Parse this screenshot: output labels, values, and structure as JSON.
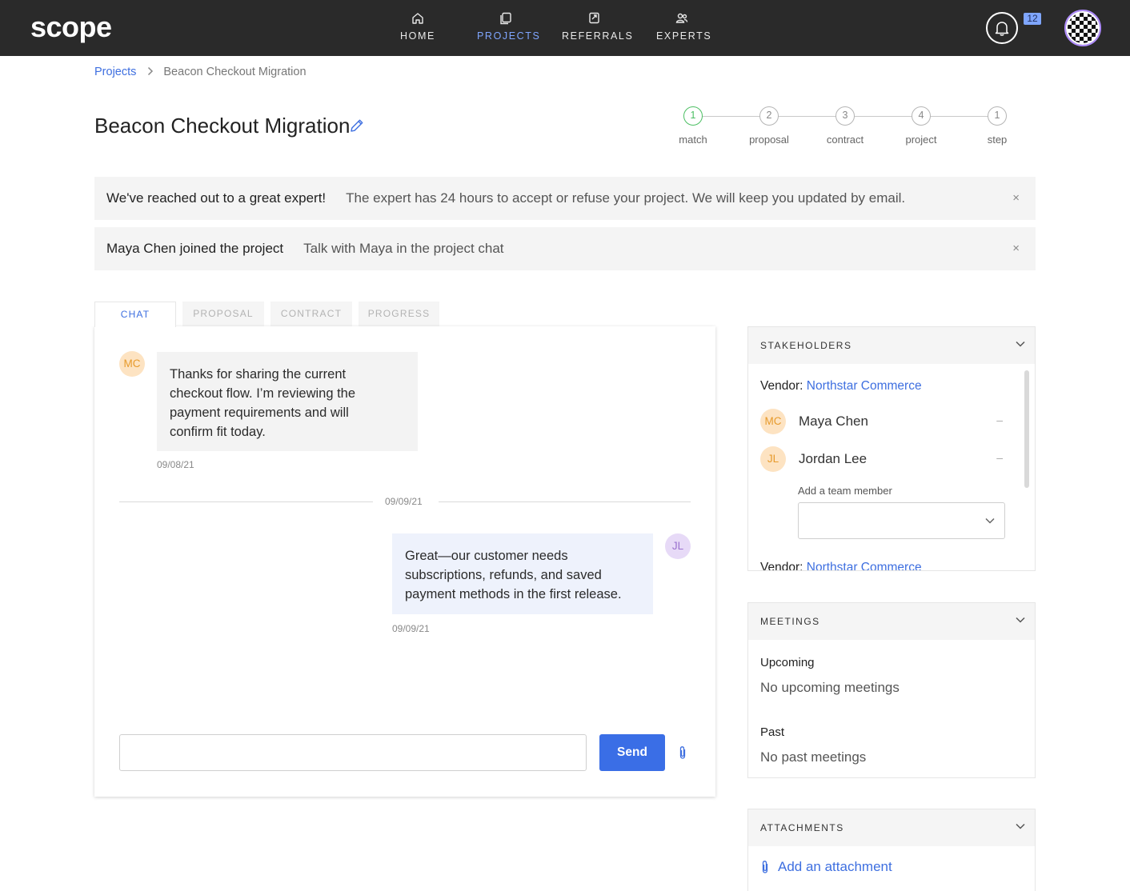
{
  "app": {
    "logo": "scope"
  },
  "nav": {
    "items": [
      {
        "label": "HOME",
        "icon": "home-icon"
      },
      {
        "label": "PROJECTS",
        "icon": "projects-icon",
        "active": true
      },
      {
        "label": "REFERRALS",
        "icon": "referrals-icon"
      },
      {
        "label": "EXPERTS",
        "icon": "experts-icon"
      }
    ],
    "notification_count": "12"
  },
  "breadcrumb": {
    "parent": "Projects",
    "current": "Beacon Checkout Migration"
  },
  "page": {
    "title": "Beacon Checkout Migration"
  },
  "stepper": {
    "steps": [
      {
        "num": "1",
        "label": "match",
        "active": true
      },
      {
        "num": "2",
        "label": "proposal"
      },
      {
        "num": "3",
        "label": "contract"
      },
      {
        "num": "4",
        "label": "project"
      },
      {
        "num": "1",
        "label": "step"
      }
    ]
  },
  "alerts": [
    {
      "title": "We've reached out to a great expert!",
      "message": "The expert has 24 hours to accept or refuse your project. We will keep you updated by email.",
      "close": "×"
    },
    {
      "title": "Maya Chen joined the project",
      "message": "Talk with Maya in the project chat",
      "close": "×"
    }
  ],
  "tabs": [
    "CHAT",
    "PROPOSAL",
    "CONTRACT",
    "PROGRESS"
  ],
  "chat": {
    "messages": [
      {
        "initials": "MC",
        "lines": [
          "Thanks for sharing the current",
          "checkout flow. I’m reviewing the",
          "payment requirements and will",
          "confirm fit today."
        ],
        "date": "09/08/21"
      },
      {
        "initials": "JL",
        "lines": [
          "Great—our customer needs",
          "subscriptions, refunds, and saved",
          "payment methods in the first release."
        ],
        "date": "09/09/21"
      }
    ],
    "divider_date": "09/09/21",
    "input_placeholder": "",
    "send_label": "Send"
  },
  "stakeholders": {
    "title": "STAKEHOLDERS",
    "vendor_label": "Vendor:",
    "vendor_name": "Northstar Commerce",
    "members": [
      {
        "initials": "MC",
        "name": "Maya Chen",
        "remove": "–"
      },
      {
        "initials": "JL",
        "name": "Jordan Lee",
        "remove": "–"
      }
    ],
    "add_member_label": "Add a team member",
    "vendor2_label": "Vendor:",
    "vendor2_name": "Northstar Commerce"
  },
  "meetings": {
    "title": "MEETINGS",
    "upcoming_label": "Upcoming",
    "upcoming_value": "No upcoming meetings",
    "past_label": "Past",
    "past_value": "No past meetings"
  },
  "attachments": {
    "title": "ATTACHMENTS",
    "add_label": "Add an attachment"
  },
  "colors": {
    "accent": "#3a6ee6",
    "nav_bg": "#2a2a2a",
    "active_nav": "#7fa6ff",
    "step_active": "#4cbf63"
  }
}
